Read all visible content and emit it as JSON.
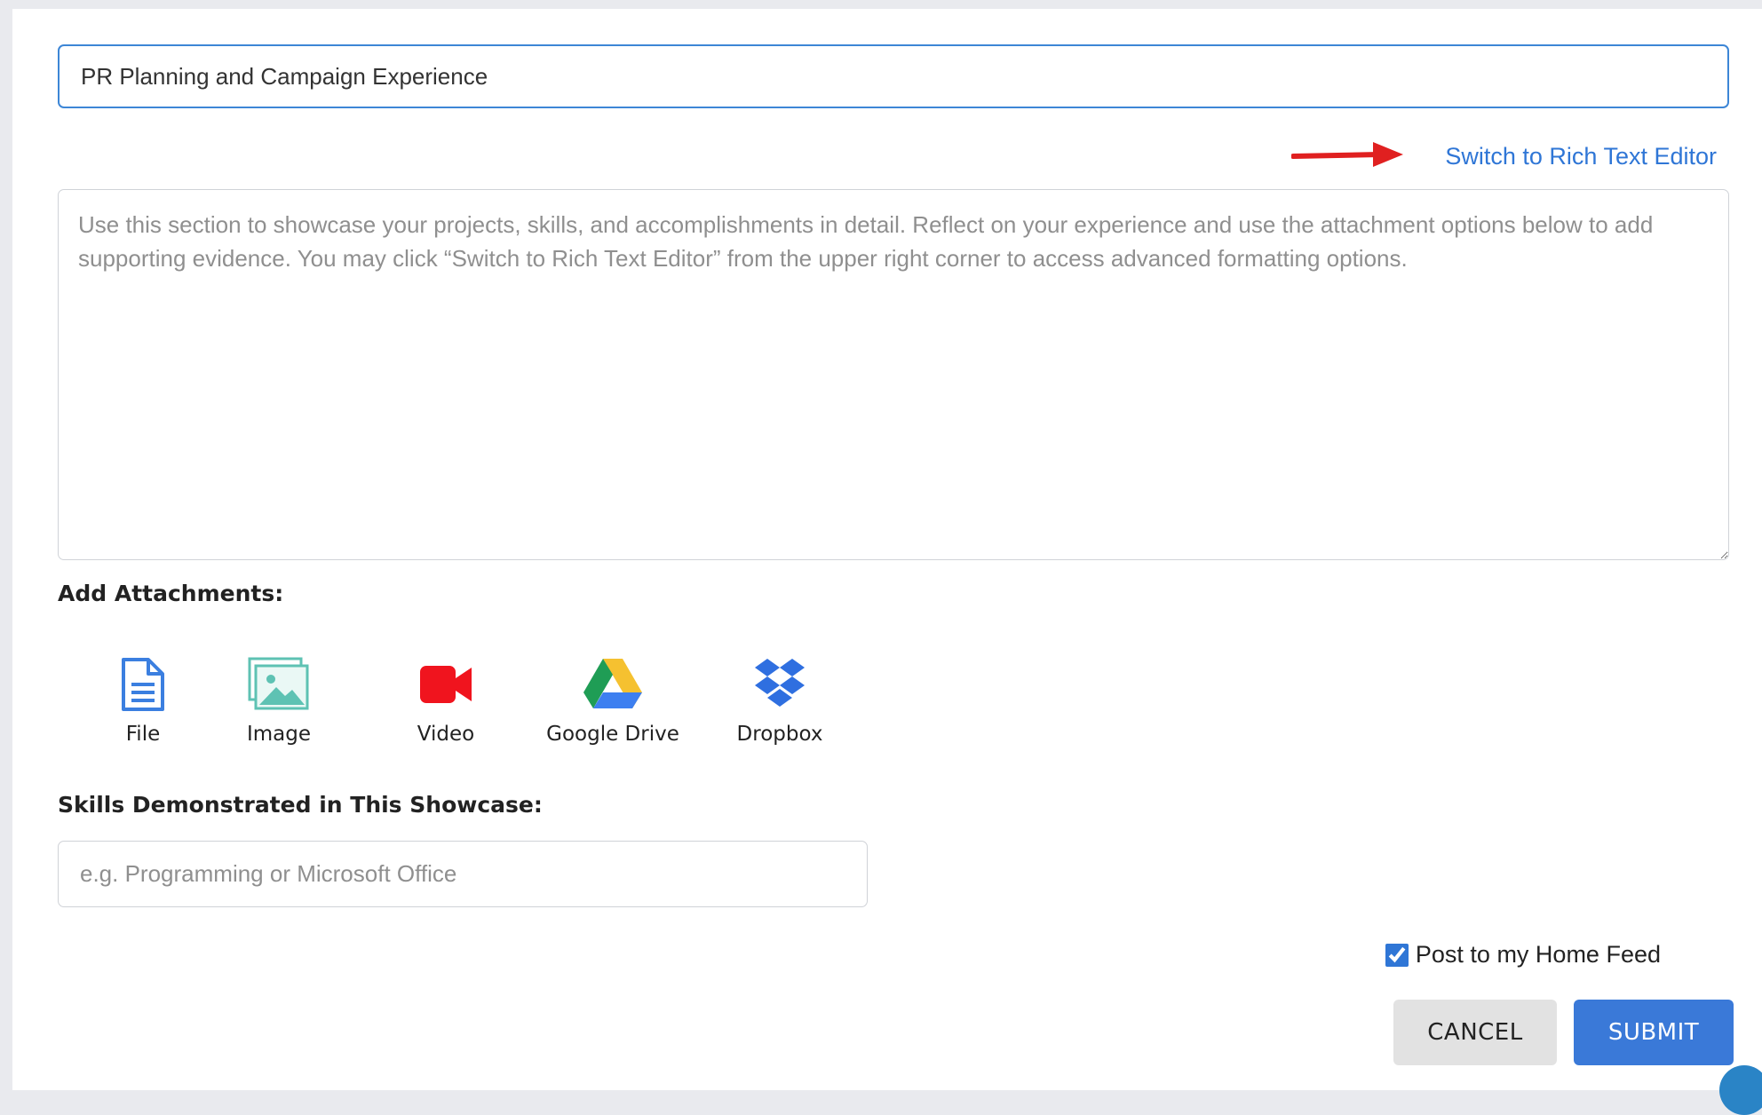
{
  "form": {
    "title_value": "PR Planning and Campaign Experience",
    "switch_editor_label": "Switch to Rich Text Editor",
    "body_placeholder": "Use this section to showcase your projects, skills, and accomplishments in detail. Reflect on your experience and use the attachment options below to add supporting evidence. You may click “Switch to Rich Text Editor” from the upper right corner to access advanced formatting options.",
    "attachments_heading": "Add Attachments:",
    "attachments": [
      {
        "label": "File",
        "icon": "file-icon"
      },
      {
        "label": "Image",
        "icon": "image-icon"
      },
      {
        "label": "Video",
        "icon": "video-icon"
      },
      {
        "label": "Google Drive",
        "icon": "google-drive-icon"
      },
      {
        "label": "Dropbox",
        "icon": "dropbox-icon"
      }
    ],
    "skills_heading": "Skills Demonstrated in This Showcase:",
    "skills_placeholder": "e.g. Programming or Microsoft Office",
    "post_to_feed_label": "Post to my Home Feed",
    "post_to_feed_checked": true,
    "cancel_label": "CANCEL",
    "submit_label": "SUBMIT"
  },
  "colors": {
    "accent": "#3a79d8",
    "link": "#2f76d6",
    "annotation_arrow": "#e02020"
  }
}
